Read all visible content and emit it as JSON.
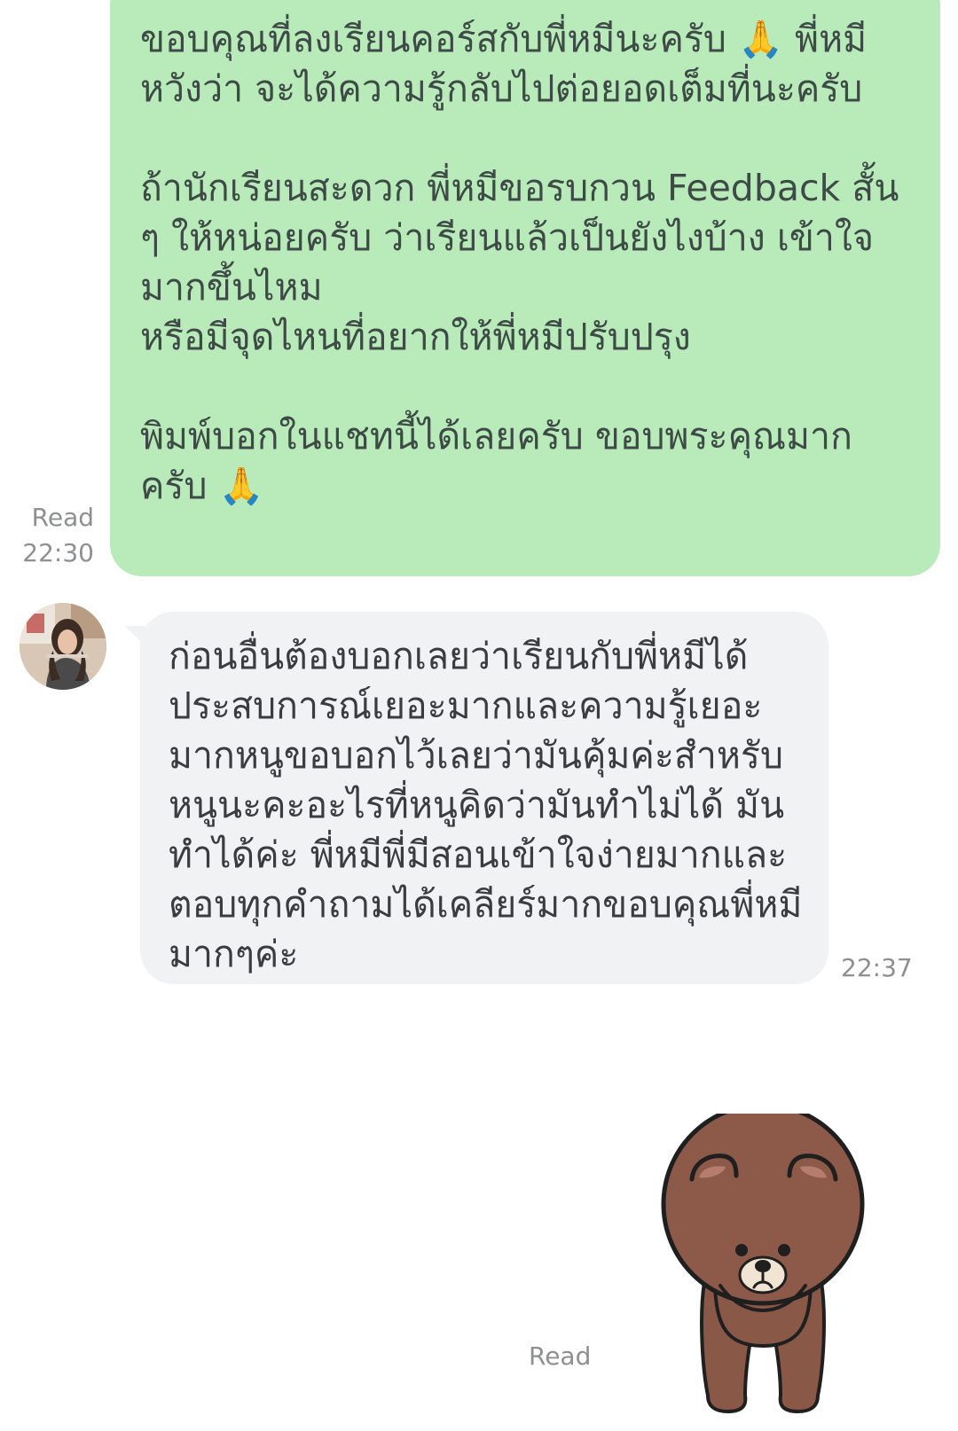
{
  "messages": {
    "outgoing": {
      "text": "ขอบคุณที่ลงเรียนคอร์สกับพี่หมีนะครับ 🙏 พี่หมีหวังว่า จะได้ความรู้กลับไปต่อยอดเต็มที่นะครับ\n\nถ้านักเรียนสะดวก พี่หมีขอรบกวน Feedback สั้น ๆ ให้หน่อยครับ ว่าเรียนแล้วเป็นยังไงบ้าง เข้าใจมากขึ้นไหม\nหรือมีจุดไหนที่อยากให้พี่หมีปรับปรุง\n\nพิมพ์บอกในแชทนี้ได้เลยครับ ขอบพระคุณมากครับ 🙏",
      "status": "Read",
      "time": "22:30"
    },
    "incoming": {
      "text": "ก่อนอื่นต้องบอกเลยว่าเรียนกับพี่หมีได้ประสบการณ์เยอะมากและความรู้เยอะมากหนูขอบอกไว้เลยว่ามันคุ้มค่ะสำหรับหนูนะคะอะไรที่หนูคิดว่ามันทำไม่ได้ มันทำได้ค่ะ พี่หมีพี่มีสอนเข้าใจง่ายมากและตอบทุกคำถามได้เคลียร์มากขอบคุณพี่หมีมากๆค่ะ",
      "time": "22:37"
    },
    "sticker": {
      "status": "Read"
    }
  },
  "colors": {
    "outgoing_bubble": "#b8ebb9",
    "incoming_bubble": "#f1f2f4",
    "meta_text": "#8d8f91"
  }
}
